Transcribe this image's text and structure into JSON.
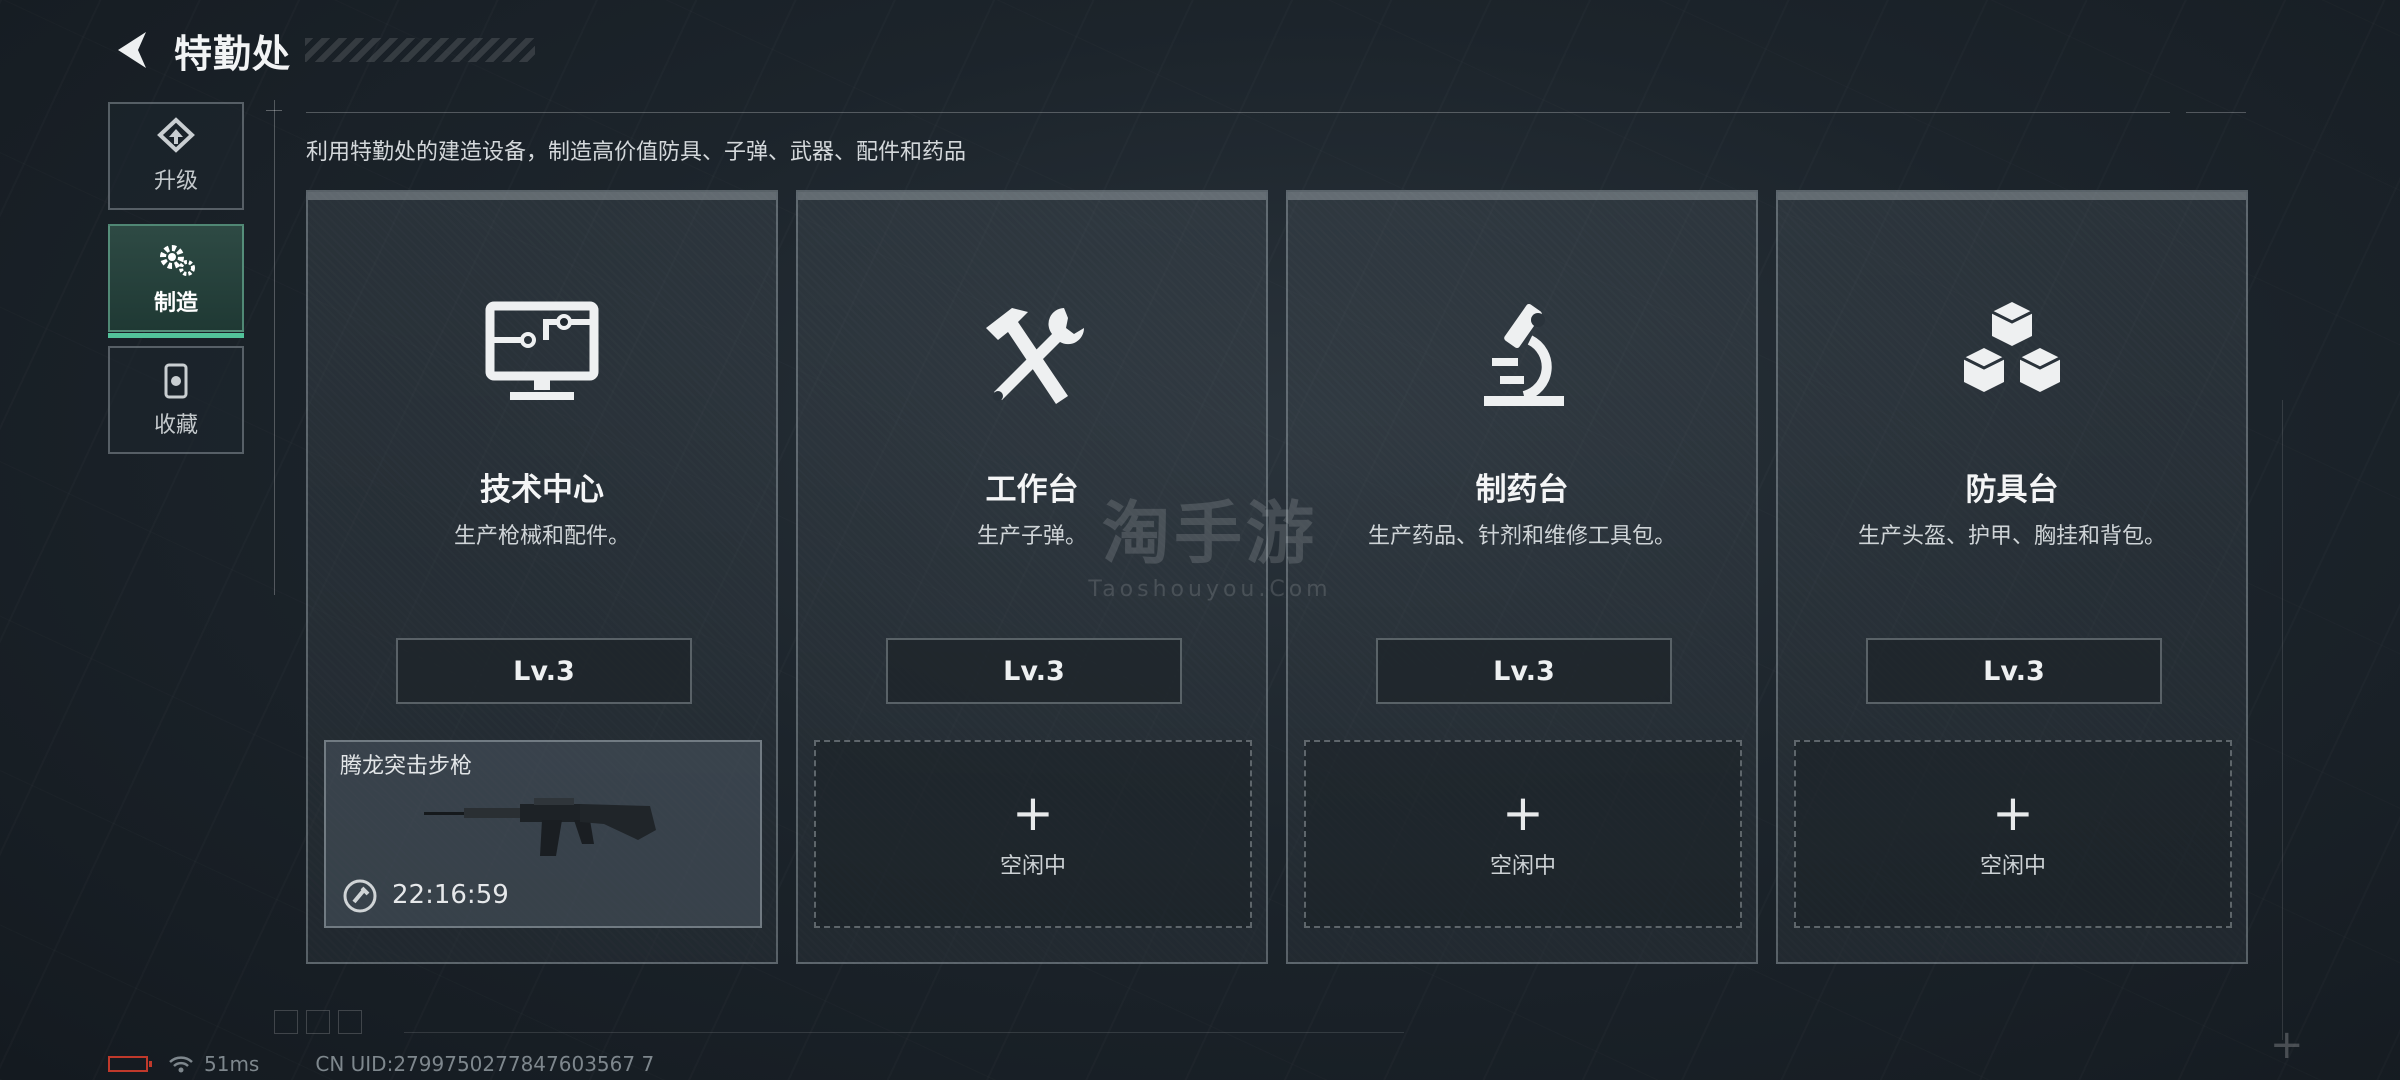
{
  "header": {
    "title": "特勤处"
  },
  "side_nav": [
    {
      "label": "升级",
      "icon": "upgrade-icon",
      "active": false
    },
    {
      "label": "制造",
      "icon": "gear-icon",
      "active": true
    },
    {
      "label": "收藏",
      "icon": "collection-icon",
      "active": false
    }
  ],
  "description": "利用特勤处的建造设备，制造高价值防具、子弹、武器、配件和药品",
  "cards": [
    {
      "title": "技术中心",
      "subtitle": "生产枪械和配件。",
      "level": "Lv.3",
      "icon": "computer-icon",
      "slot": {
        "status": "busy",
        "item_name": "腾龙突击步枪",
        "timer": "22:16:59",
        "item_icon": "rifle-icon"
      }
    },
    {
      "title": "工作台",
      "subtitle": "生产子弹。",
      "level": "Lv.3",
      "icon": "hammer-wrench-icon",
      "slot": {
        "status": "idle",
        "plus": "+",
        "text": "空闲中"
      }
    },
    {
      "title": "制药台",
      "subtitle": "生产药品、针剂和维修工具包。",
      "level": "Lv.3",
      "icon": "microscope-icon",
      "slot": {
        "status": "idle",
        "plus": "+",
        "text": "空闲中"
      }
    },
    {
      "title": "防具台",
      "subtitle": "生产头盔、护甲、胸挂和背包。",
      "level": "Lv.3",
      "icon": "cubes-icon",
      "slot": {
        "status": "idle",
        "plus": "+",
        "text": "空闲中"
      }
    }
  ],
  "watermark": {
    "main": "淘手游",
    "sub": "Taoshouyou.Com"
  },
  "footer": {
    "ping": "51ms",
    "uid": "CN UID:2799750277847603567 7"
  },
  "colors": {
    "accent": "#52c39a",
    "battery": "#c0392b"
  }
}
